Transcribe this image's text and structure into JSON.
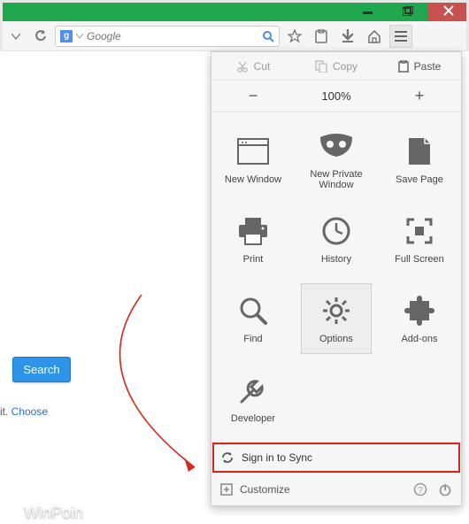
{
  "window": {
    "accent": "#1fa84d"
  },
  "toolbar": {
    "search_provider_letter": "g",
    "search_placeholder": "Google"
  },
  "panel": {
    "edit": {
      "cut": "Cut",
      "copy": "Copy",
      "paste": "Paste"
    },
    "zoom": {
      "level": "100%"
    },
    "grid": [
      {
        "label": "New Window"
      },
      {
        "label": "New Private Window"
      },
      {
        "label": "Save Page"
      },
      {
        "label": "Print"
      },
      {
        "label": "History"
      },
      {
        "label": "Full Screen"
      },
      {
        "label": "Find"
      },
      {
        "label": "Options",
        "selected": true
      },
      {
        "label": "Add-ons"
      },
      {
        "label": "Developer"
      }
    ],
    "sync": "Sign in to Sync",
    "customize": "Customize"
  },
  "page": {
    "search_button": "Search",
    "choose_prefix": " it. ",
    "choose_link": "Choose"
  },
  "watermark": "WinPoin"
}
